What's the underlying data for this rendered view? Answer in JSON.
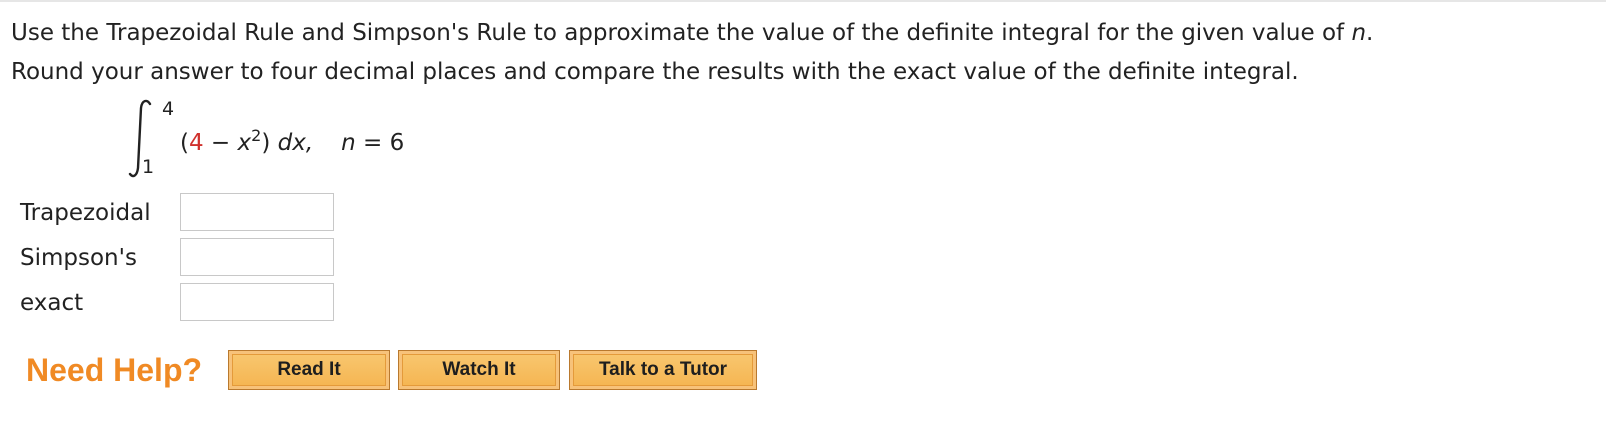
{
  "question": {
    "line1_prefix": "Use the Trapezoidal Rule and Simpson's Rule to approximate the value of the definite integral for the given value of ",
    "line1_var": "n",
    "line1_suffix": ".",
    "line2": "Round your answer to four decimal places and compare the results with the exact value of the definite integral."
  },
  "formula": {
    "upper_limit": "4",
    "lower_limit": "1",
    "open_paren": "(",
    "constant": "4",
    "minus": " − ",
    "variable": "x",
    "exponent": "2",
    "close_paren": ")",
    "differential": "dx,",
    "n_var": "n",
    "n_equals": " = 6",
    "colors": {
      "constant": "#d0312d"
    }
  },
  "answers": [
    {
      "label": "Trapezoidal",
      "value": ""
    },
    {
      "label": "Simpson's",
      "value": ""
    },
    {
      "label": "exact",
      "value": ""
    }
  ],
  "help": {
    "title": "Need Help?",
    "title_color": "#f08a24",
    "buttons": {
      "read": "Read It",
      "watch": "Watch It",
      "tutor": "Talk to a Tutor"
    }
  }
}
